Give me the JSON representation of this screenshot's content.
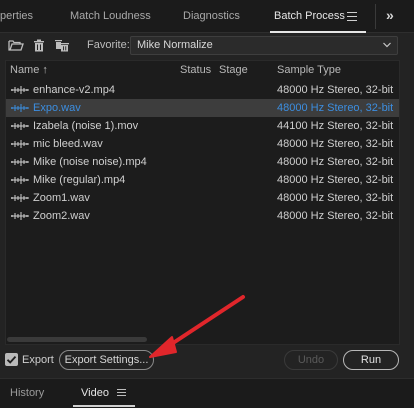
{
  "tabs": [
    {
      "label": "perties"
    },
    {
      "label": "Match Loudness"
    },
    {
      "label": "Diagnostics"
    },
    {
      "label": "Batch Process"
    }
  ],
  "overflow_label": "»",
  "toolbar": {
    "favorite_label": "Favorite:",
    "favorite_value": "Mike Normalize",
    "icons": [
      "folder-open-icon",
      "trash-icon",
      "trash-all-icon"
    ]
  },
  "columns": {
    "name": "Name",
    "sort_indicator": "↑",
    "status": "Status",
    "stage": "Stage",
    "sample_type": "Sample Type"
  },
  "files": [
    {
      "name": "enhance-v2.mp4",
      "sample_type": "48000 Hz Stereo, 32-bit",
      "selected": false
    },
    {
      "name": "Expo.wav",
      "sample_type": "48000 Hz Stereo, 32-bit",
      "selected": true
    },
    {
      "name": "Izabela (noise 1).mov",
      "sample_type": "44100 Hz Stereo, 32-bit",
      "selected": false
    },
    {
      "name": "mic bleed.wav",
      "sample_type": "48000 Hz Stereo, 32-bit",
      "selected": false
    },
    {
      "name": "Mike (noise noise).mp4",
      "sample_type": "48000 Hz Stereo, 32-bit",
      "selected": false
    },
    {
      "name": "Mike (regular).mp4",
      "sample_type": "48000 Hz Stereo, 32-bit",
      "selected": false
    },
    {
      "name": "Zoom1.wav",
      "sample_type": "48000 Hz Stereo, 32-bit",
      "selected": false
    },
    {
      "name": "Zoom2.wav",
      "sample_type": "48000 Hz Stereo, 32-bit",
      "selected": false
    }
  ],
  "controls": {
    "export_checkbox_label": "Export",
    "export_checked": true,
    "export_settings_label": "Export Settings...",
    "undo_label": "Undo",
    "run_label": "Run"
  },
  "bottom_tabs": [
    {
      "label": "History"
    },
    {
      "label": "Video"
    }
  ],
  "colors": {
    "selected_text": "#3c8ee0",
    "annotation_arrow": "#e0262b"
  }
}
